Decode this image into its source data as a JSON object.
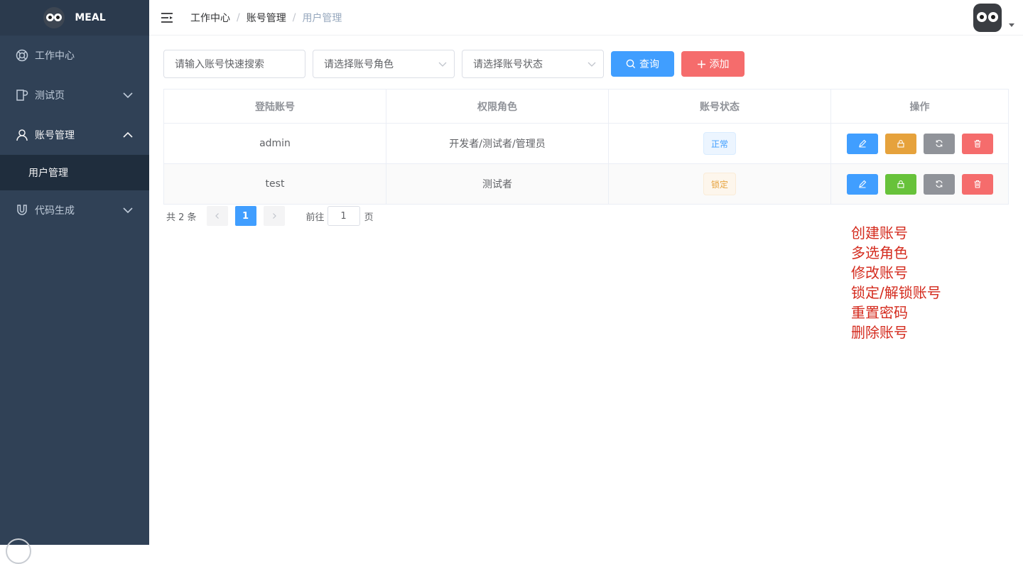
{
  "app": {
    "name": "MEAL"
  },
  "sidebar": {
    "items": [
      {
        "label": "工作中心",
        "icon": "lifebuoy-icon"
      },
      {
        "label": "测试页",
        "icon": "document-icon"
      },
      {
        "label": "账号管理",
        "icon": "user-icon",
        "expanded": true,
        "children": [
          {
            "label": "用户管理",
            "active": true
          }
        ]
      },
      {
        "label": "代码生成",
        "icon": "magnet-icon"
      }
    ]
  },
  "breadcrumb": [
    "工作中心",
    "账号管理",
    "用户管理"
  ],
  "breadcrumb_sep": "/",
  "filters": {
    "search_placeholder": "请输入账号快速搜索",
    "role_placeholder": "请选择账号角色",
    "status_placeholder": "请选择账号状态",
    "query_label": "查询",
    "add_label": "添加"
  },
  "table": {
    "columns": [
      "登陆账号",
      "权限角色",
      "账号状态",
      "操作"
    ],
    "rows": [
      {
        "account": "admin",
        "roles": "开发者/测试者/管理员",
        "status": "正常"
      },
      {
        "account": "test",
        "roles": "测试者",
        "status": "锁定"
      }
    ]
  },
  "pagination": {
    "total_text": "共 2 条",
    "current": "1",
    "goto_label": "前往",
    "goto_value": "1",
    "page_label": "页"
  },
  "notes": [
    "创建账号",
    "多选角色",
    "修改账号",
    "锁定/解锁账号",
    "重置密码",
    "删除账号"
  ],
  "colors": {
    "primary": "#409eff",
    "danger": "#f56c6c",
    "warning": "#e6a23c",
    "success": "#67c23a",
    "info": "#909399",
    "sidebar": "#304156",
    "note": "#d42b1e"
  }
}
